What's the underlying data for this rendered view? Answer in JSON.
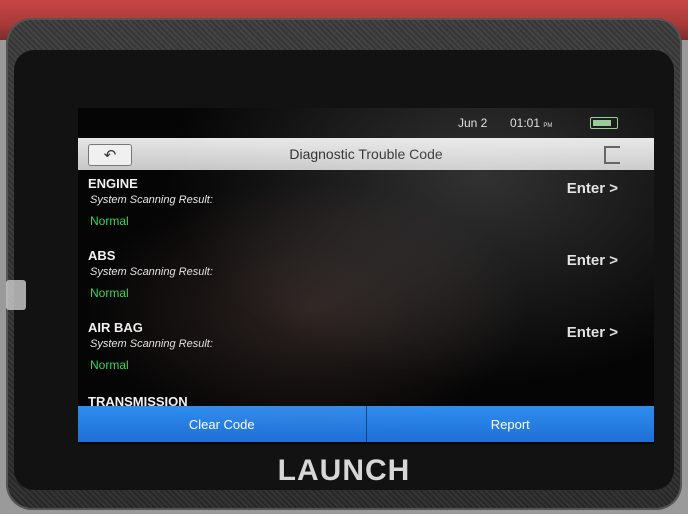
{
  "status": {
    "date": "Jun 2",
    "time": "01:01",
    "ampm": "PM"
  },
  "header": {
    "title": "Diagnostic Trouble Code"
  },
  "systems": [
    {
      "name": "ENGINE",
      "label": "System Scanning Result:",
      "value": "Normal",
      "action": "Enter >"
    },
    {
      "name": "ABS",
      "label": "System Scanning Result:",
      "value": "Normal",
      "action": "Enter >"
    },
    {
      "name": "AIR BAG",
      "label": "System Scanning Result:",
      "value": "Normal",
      "action": "Enter >"
    },
    {
      "name": "TRANSMISSION"
    }
  ],
  "footer": {
    "clear_label": "Clear Code",
    "report_label": "Report"
  },
  "device": {
    "brand": "LAUNCH"
  },
  "icons": {
    "back": "back-arrow-icon",
    "exit": "exit-icon",
    "battery": "battery-icon"
  },
  "colors": {
    "accent": "#2f8df0",
    "ok": "#3ed45c"
  }
}
